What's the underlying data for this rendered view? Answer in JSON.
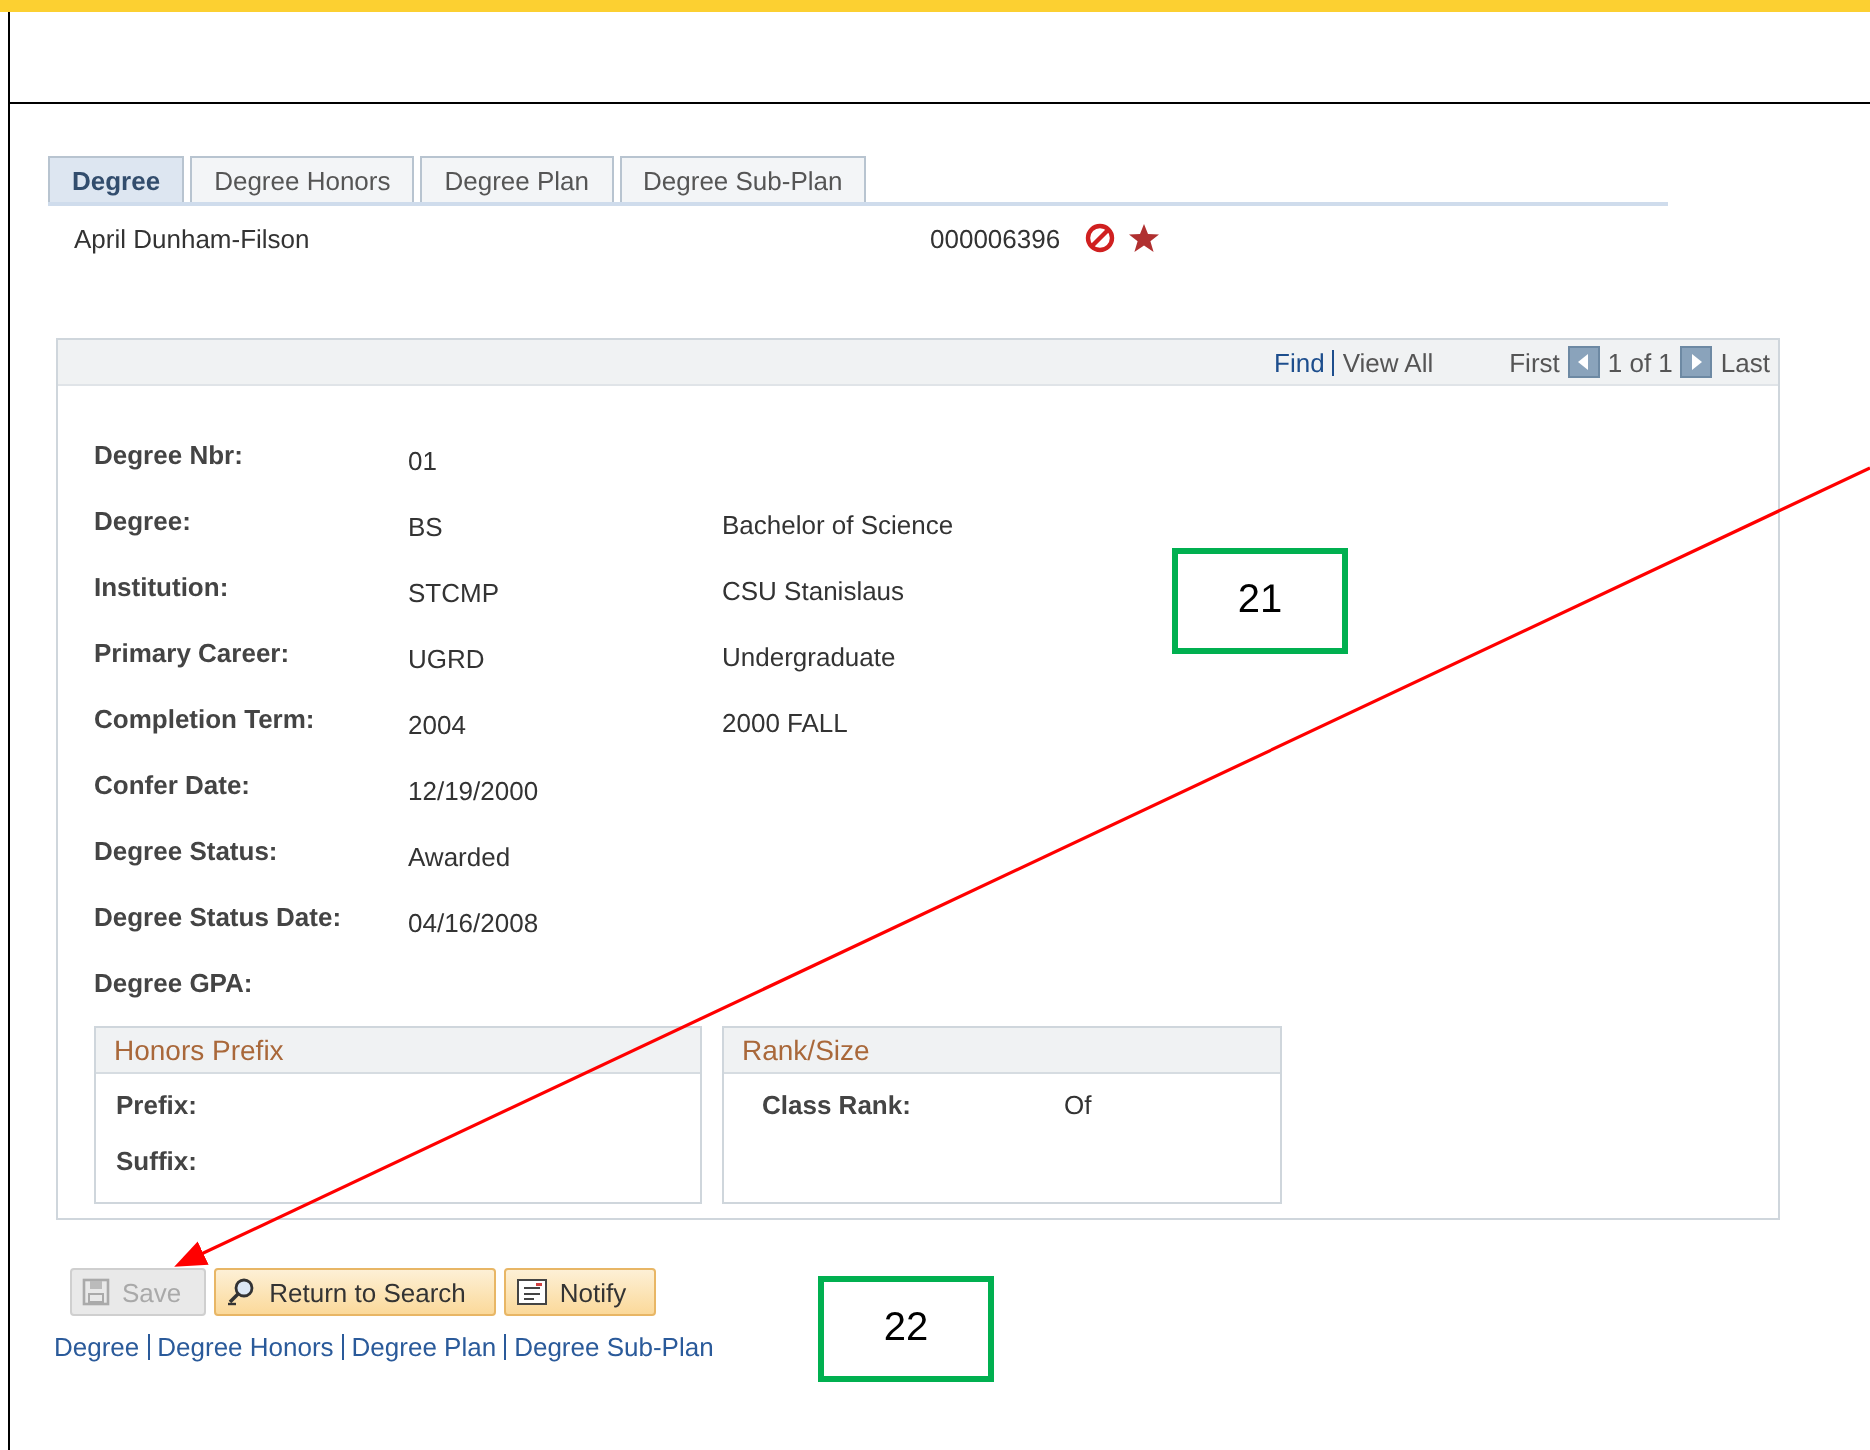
{
  "tabs": [
    {
      "label": "Degree",
      "selected": true
    },
    {
      "label": "Degree Honors",
      "selected": false
    },
    {
      "label": "Degree Plan",
      "selected": false
    },
    {
      "label": "Degree Sub-Plan",
      "selected": false
    }
  ],
  "student": {
    "name": "April Dunham-Filson",
    "id": "000006396"
  },
  "navigation": {
    "find": "Find",
    "view_all": "View All",
    "first": "First",
    "position": "1 of 1",
    "last": "Last"
  },
  "fields": [
    {
      "label": "Degree Nbr:",
      "value": "01"
    },
    {
      "label": "Degree:",
      "value": "BS",
      "description": "Bachelor of Science"
    },
    {
      "label": "Institution:",
      "value": "STCMP",
      "description": "CSU Stanislaus"
    },
    {
      "label": "Primary Career:",
      "value": "UGRD",
      "description": "Undergraduate"
    },
    {
      "label": "Completion Term:",
      "value": "2004",
      "description": "2000 FALL"
    },
    {
      "label": "Confer Date:",
      "value": "12/19/2000"
    },
    {
      "label": "Degree Status:",
      "value": "Awarded"
    },
    {
      "label": "Degree Status Date:",
      "value": "04/16/2008"
    },
    {
      "label": "Degree GPA:"
    }
  ],
  "honors_prefix": {
    "title": "Honors Prefix",
    "fields": [
      {
        "label": "Prefix:"
      },
      {
        "label": "Suffix:"
      }
    ]
  },
  "rank_size": {
    "title": "Rank/Size",
    "fields": [
      {
        "label": "Class Rank:",
        "value": "Of"
      }
    ]
  },
  "buttons": [
    {
      "label": "Save",
      "kind": "save",
      "disabled": true
    },
    {
      "label": "Return to Search",
      "kind": "search",
      "disabled": false
    },
    {
      "label": "Notify",
      "kind": "notify",
      "disabled": false
    }
  ],
  "footer_links": [
    "Degree",
    "Degree Honors",
    "Degree Plan",
    "Degree Sub-Plan"
  ],
  "callouts": [
    "21",
    "22"
  ]
}
